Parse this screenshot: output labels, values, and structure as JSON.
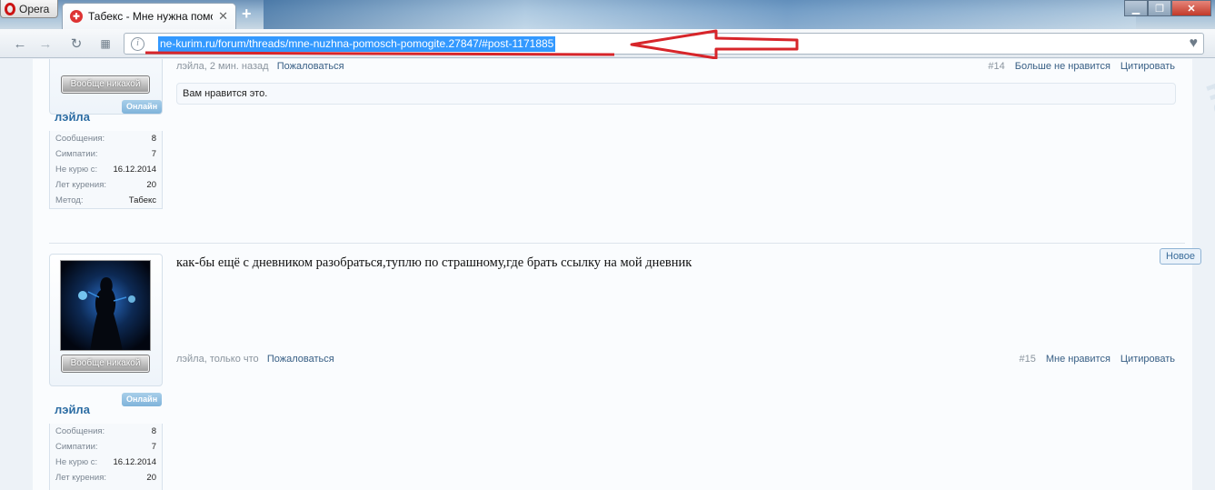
{
  "browser": {
    "menu_label": "Opera",
    "tab_title": "Табекс - Мне нужна помо",
    "tab_close": "✕",
    "new_tab": "+",
    "address": "ne-kurim.ru/forum/threads/mne-nuzhna-pomosch-pomogite.27847/#post-1171885"
  },
  "posts": [
    {
      "user": {
        "rank": "Вообще никакой",
        "online": "Онлайн",
        "name": "лэйла",
        "stats": [
          {
            "label": "Сообщения:",
            "value": "8"
          },
          {
            "label": "Симпатии:",
            "value": "7"
          },
          {
            "label": "Не курю с:",
            "value": "16.12.2014"
          },
          {
            "label": "Лет курения:",
            "value": "20"
          },
          {
            "label": "Метод:",
            "value": "Табекс"
          }
        ]
      },
      "author": "лэйла",
      "time": ", 2 мин. назад",
      "report": "Пожаловаться",
      "number": "#14",
      "like": "Больше не нравится",
      "quote": "Цитировать",
      "likes_text": "Вам нравится это."
    },
    {
      "badge": "Новое",
      "message": "как-бы ещё с дневником разобраться,туплю по страшному,где брать ссылку на мой дневник",
      "user": {
        "rank": "Вообще никакой",
        "online": "Онлайн",
        "name": "лэйла",
        "stats": [
          {
            "label": "Сообщения:",
            "value": "8"
          },
          {
            "label": "Симпатии:",
            "value": "7"
          },
          {
            "label": "Не курю с:",
            "value": "16.12.2014"
          },
          {
            "label": "Лет курения:",
            "value": "20"
          }
        ]
      },
      "author": "лэйла",
      "time": ", только что",
      "report": "Пожаловаться",
      "number": "#15",
      "like": "Мне нравится",
      "quote": "Цитировать"
    }
  ]
}
